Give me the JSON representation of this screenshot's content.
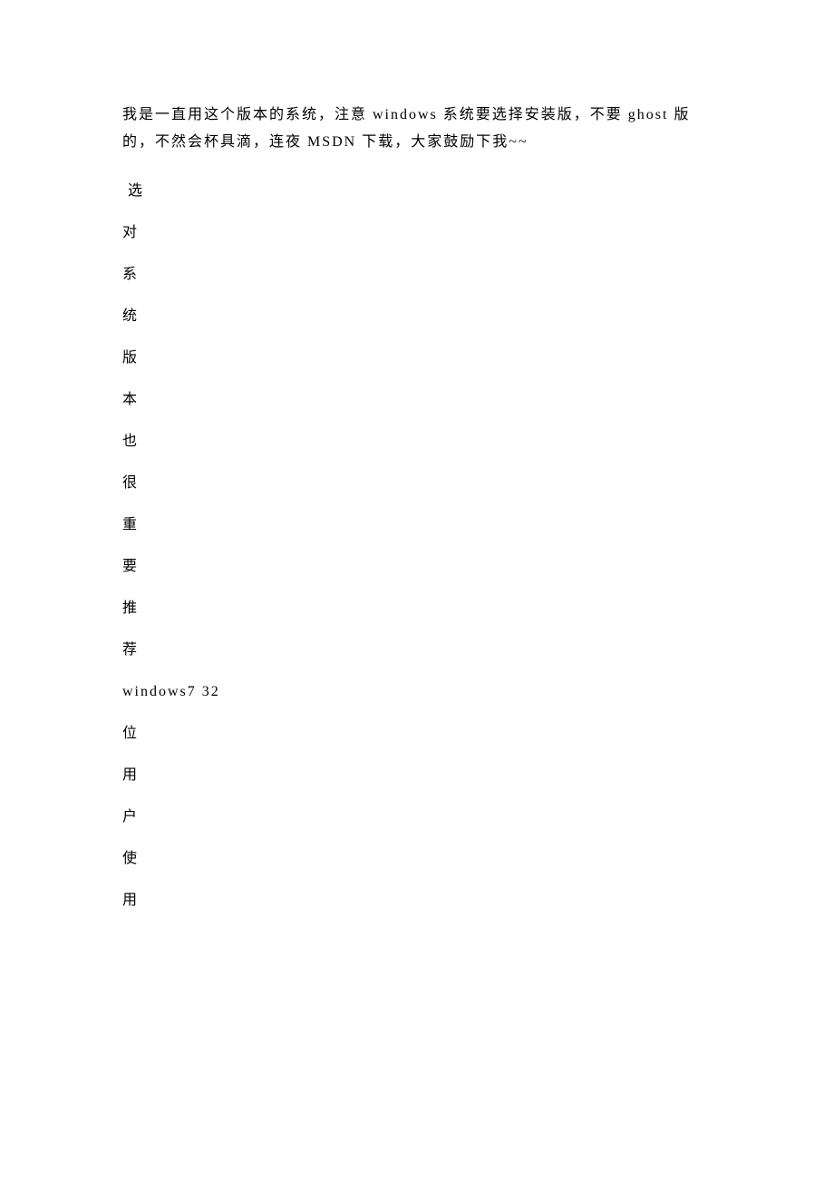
{
  "intro": "我是一直用这个版本的系统，注意 windows 系统要选择安装版，不要 ghost 版的，不然会杯具滴，连夜 MSDN 下载，大家鼓励下我~~",
  "lines": {
    "l0": "选",
    "l1": "对",
    "l2": "系",
    "l3": "统",
    "l4": "版",
    "l5": "本",
    "l6": "也",
    "l7": "很",
    "l8": "重",
    "l9": "要",
    "l10": "推",
    "l11": "荐",
    "l12": "windows7 32",
    "l13": "位",
    "l14": "用",
    "l15": "户",
    "l16": "使",
    "l17": "用"
  }
}
